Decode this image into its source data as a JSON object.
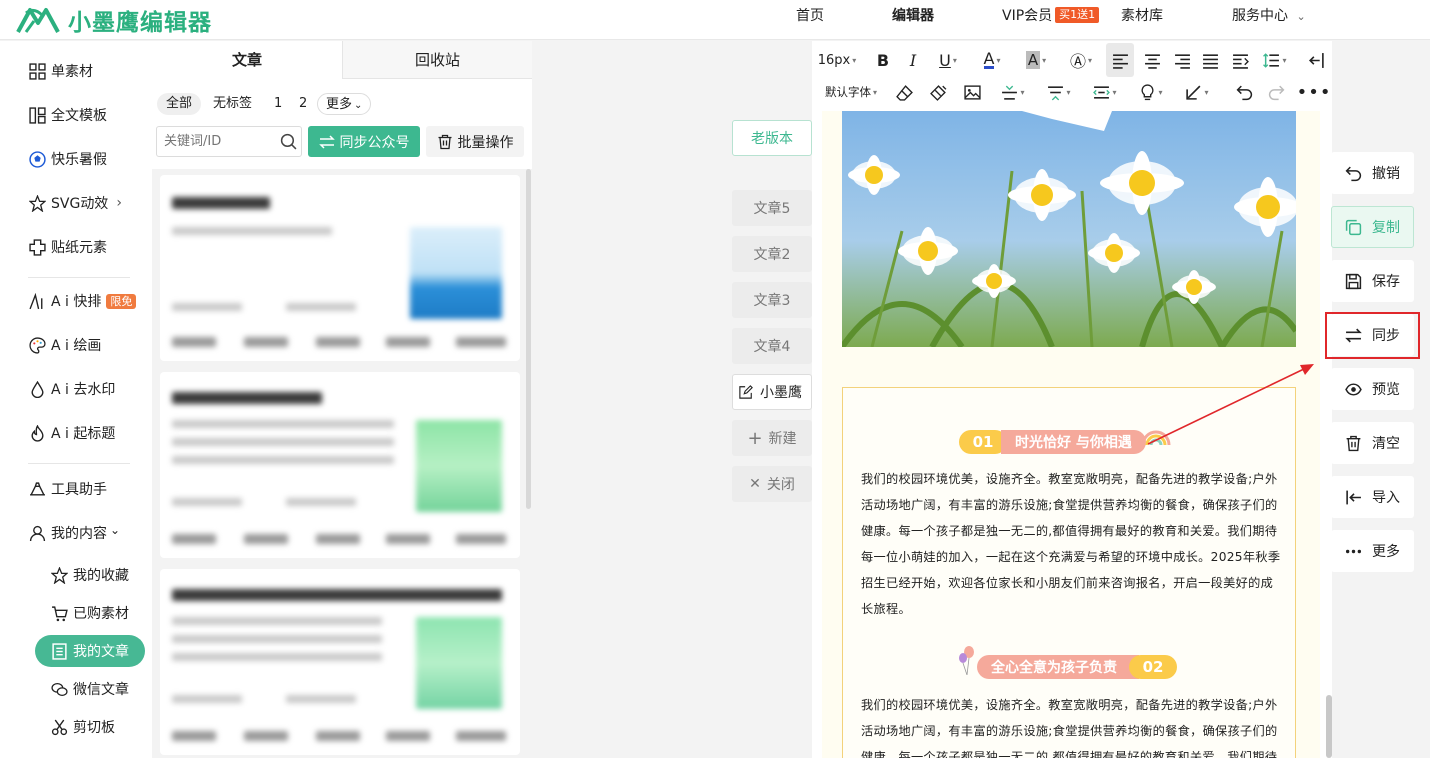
{
  "app": {
    "name": "小墨鹰编辑器",
    "brand_color": "#2bb07f",
    "accent_color": "#3db890"
  },
  "nav": {
    "items": [
      "首页",
      "编辑器",
      "VIP会员",
      "素材库",
      "服务中心"
    ],
    "vip_badge": "买1送1",
    "caret": "⌄"
  },
  "sidebar": {
    "items": [
      {
        "label": "单素材",
        "icon": "grid-icon"
      },
      {
        "label": "全文模板",
        "icon": "template-icon"
      },
      {
        "label": "快乐暑假",
        "icon": "ball-icon"
      },
      {
        "label": "SVG动效",
        "icon": "star-icon",
        "chevron": "›"
      },
      {
        "label": "贴纸元素",
        "icon": "sticker-icon"
      },
      {
        "label": "A i 快排",
        "icon": "ai-icon",
        "badge": "限免"
      },
      {
        "label": "A i 绘画",
        "icon": "palette-icon"
      },
      {
        "label": "A i 去水印",
        "icon": "drop-icon"
      },
      {
        "label": "A i 起标题",
        "icon": "fire-icon"
      },
      {
        "label": "工具助手",
        "icon": "tool-icon"
      },
      {
        "label": "我的内容",
        "icon": "user-icon",
        "chevron": "⌄"
      }
    ],
    "sub_items": [
      {
        "label": "我的收藏",
        "icon": "star-icon"
      },
      {
        "label": "已购素材",
        "icon": "cart-icon"
      },
      {
        "label": "我的文章",
        "icon": "article-icon",
        "active": true
      },
      {
        "label": "微信文章",
        "icon": "wechat-icon"
      },
      {
        "label": "剪切板",
        "icon": "scissors-icon"
      }
    ]
  },
  "article_panel": {
    "tabs": [
      "文章",
      "回收站"
    ],
    "filters": [
      "全部",
      "无标签",
      "1",
      "2",
      "更多"
    ],
    "more_caret": "⌄",
    "search_placeholder": "关键词/ID",
    "sync_button": "同步公众号",
    "batch_button": "批量操作"
  },
  "workspace": {
    "old_version": "老版本",
    "article_tabs": [
      "文章5",
      "文章2",
      "文章3",
      "文章4",
      "小墨鹰"
    ],
    "new_label": "新建",
    "close_label": "关闭"
  },
  "editor": {
    "font_size": "16px",
    "font_family": "默认字体",
    "section1": {
      "num": "01",
      "title": "时光恰好 与你相遇"
    },
    "section2": {
      "num": "02",
      "title": "全心全意为孩子负责"
    },
    "paragraph": "我们的校园环境优美，设施齐全。教室宽敞明亮，配备先进的教学设备;户外活动场地广阔，有丰富的游乐设施;食堂提供营养均衡的餐食，确保孩子们的健康。每一个孩子都是独一无二的,都值得拥有最好的教育和关爱。我们期待每一位小萌娃的加入，一起在这个充满爱与希望的环境中成长。2025年秋季招生已经开始，欢迎各位家长和小朋友们前来咨询报名，开启一段美好的成长旅程。"
  },
  "actions": [
    {
      "label": "撤销",
      "icon": "undo-icon"
    },
    {
      "label": "复制",
      "icon": "copy-icon"
    },
    {
      "label": "保存",
      "icon": "save-icon"
    },
    {
      "label": "同步",
      "icon": "sync-icon"
    },
    {
      "label": "预览",
      "icon": "eye-icon"
    },
    {
      "label": "清空",
      "icon": "trash-icon"
    },
    {
      "label": "导入",
      "icon": "import-icon"
    },
    {
      "label": "更多",
      "icon": "more-icon"
    }
  ]
}
